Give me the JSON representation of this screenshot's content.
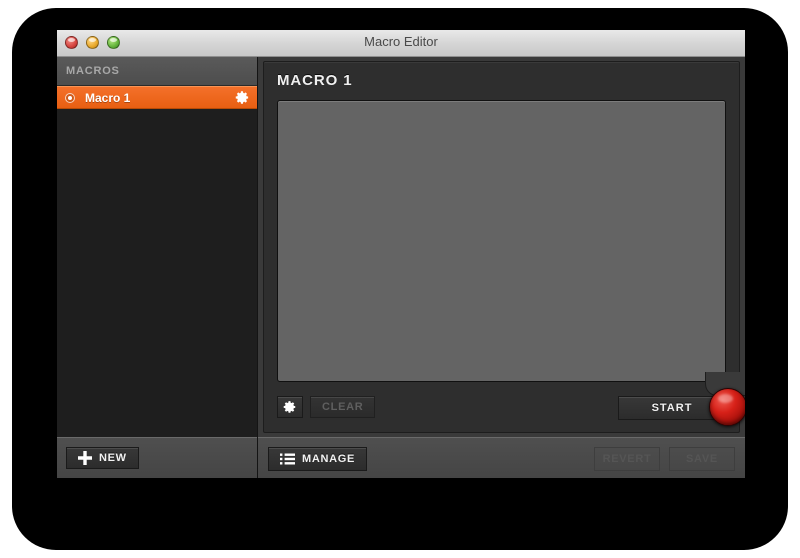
{
  "window": {
    "title": "Macro Editor",
    "traffic_lights": [
      {
        "name": "close-button",
        "color": "#d64540"
      },
      {
        "name": "minimize-button",
        "color": "#e9a92b"
      },
      {
        "name": "zoom-button",
        "color": "#63b43a"
      }
    ]
  },
  "sidebar": {
    "header_label": "MACROS",
    "items": [
      {
        "label": "Macro 1",
        "selected": true,
        "icon": "radio-icon",
        "action_icon": "gear-icon"
      }
    ],
    "new_button": {
      "label": "NEW",
      "icon": "plus-icon",
      "enabled": true
    }
  },
  "content": {
    "title": "MACRO 1",
    "canvas": {
      "name": "macro-canvas",
      "content": ""
    },
    "toolbar": {
      "settings_button": {
        "label": "",
        "icon": "gear-icon",
        "enabled": true
      },
      "clear_button": {
        "label": "CLEAR",
        "enabled": false
      },
      "start_button": {
        "label": "START",
        "enabled": true
      },
      "record_led": {
        "name": "record-led",
        "color": "#d62018",
        "active": false
      }
    }
  },
  "footer": {
    "manage_button": {
      "label": "MANAGE",
      "icon": "list-icon",
      "enabled": true
    },
    "revert_button": {
      "label": "REVERT",
      "enabled": false
    },
    "save_button": {
      "label": "SAVE",
      "enabled": false
    }
  },
  "colors": {
    "accent": "#e85f12",
    "window_chrome": "#3a3a3a",
    "panel": "#2e2e2e",
    "canvas": "#646464",
    "sidebar_list": "#1e1e1e",
    "footer_bar": "#4a4a4a",
    "record_red": "#d62018"
  }
}
